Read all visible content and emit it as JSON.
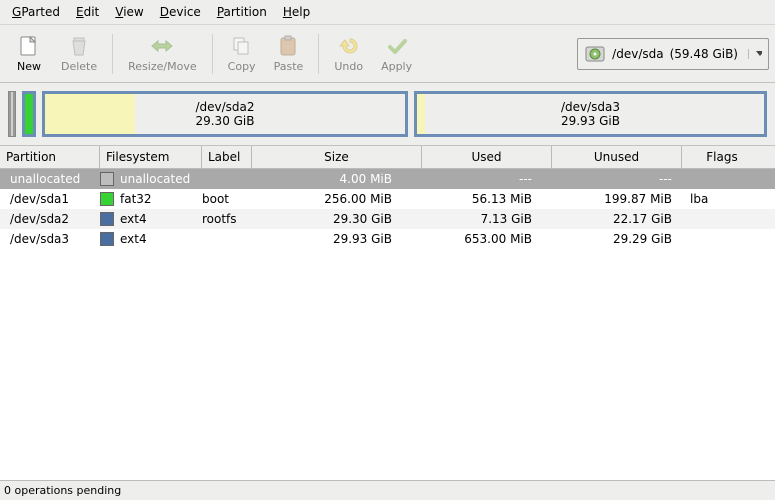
{
  "menu": {
    "gparted": "GParted",
    "edit": "Edit",
    "view": "View",
    "device": "Device",
    "partition": "Partition",
    "help": "Help"
  },
  "toolbar": {
    "new": "New",
    "delete": "Delete",
    "resize": "Resize/Move",
    "copy": "Copy",
    "paste": "Paste",
    "undo": "Undo",
    "apply": "Apply"
  },
  "device": {
    "path": "/dev/sda",
    "size": "(59.48 GiB)"
  },
  "map": {
    "sda2": {
      "name": "/dev/sda2",
      "size": "29.30 GiB"
    },
    "sda3": {
      "name": "/dev/sda3",
      "size": "29.93 GiB"
    }
  },
  "columns": {
    "partition": "Partition",
    "filesystem": "Filesystem",
    "label": "Label",
    "size": "Size",
    "used": "Used",
    "unused": "Unused",
    "flags": "Flags"
  },
  "rows": [
    {
      "partition": "unallocated",
      "fs": "unallocated",
      "swatch": "sw-unalloc",
      "label": "",
      "size": "4.00 MiB",
      "used": "---",
      "unused": "---",
      "flags": ""
    },
    {
      "partition": "/dev/sda1",
      "fs": "fat32",
      "swatch": "sw-fat32",
      "label": "boot",
      "size": "256.00 MiB",
      "used": "56.13 MiB",
      "unused": "199.87 MiB",
      "flags": "lba"
    },
    {
      "partition": "/dev/sda2",
      "fs": "ext4",
      "swatch": "sw-ext4",
      "label": "rootfs",
      "size": "29.30 GiB",
      "used": "7.13 GiB",
      "unused": "22.17 GiB",
      "flags": ""
    },
    {
      "partition": "/dev/sda3",
      "fs": "ext4",
      "swatch": "sw-ext4",
      "label": "",
      "size": "29.93 GiB",
      "used": "653.00 MiB",
      "unused": "29.29 GiB",
      "flags": ""
    }
  ],
  "status": "0 operations pending"
}
